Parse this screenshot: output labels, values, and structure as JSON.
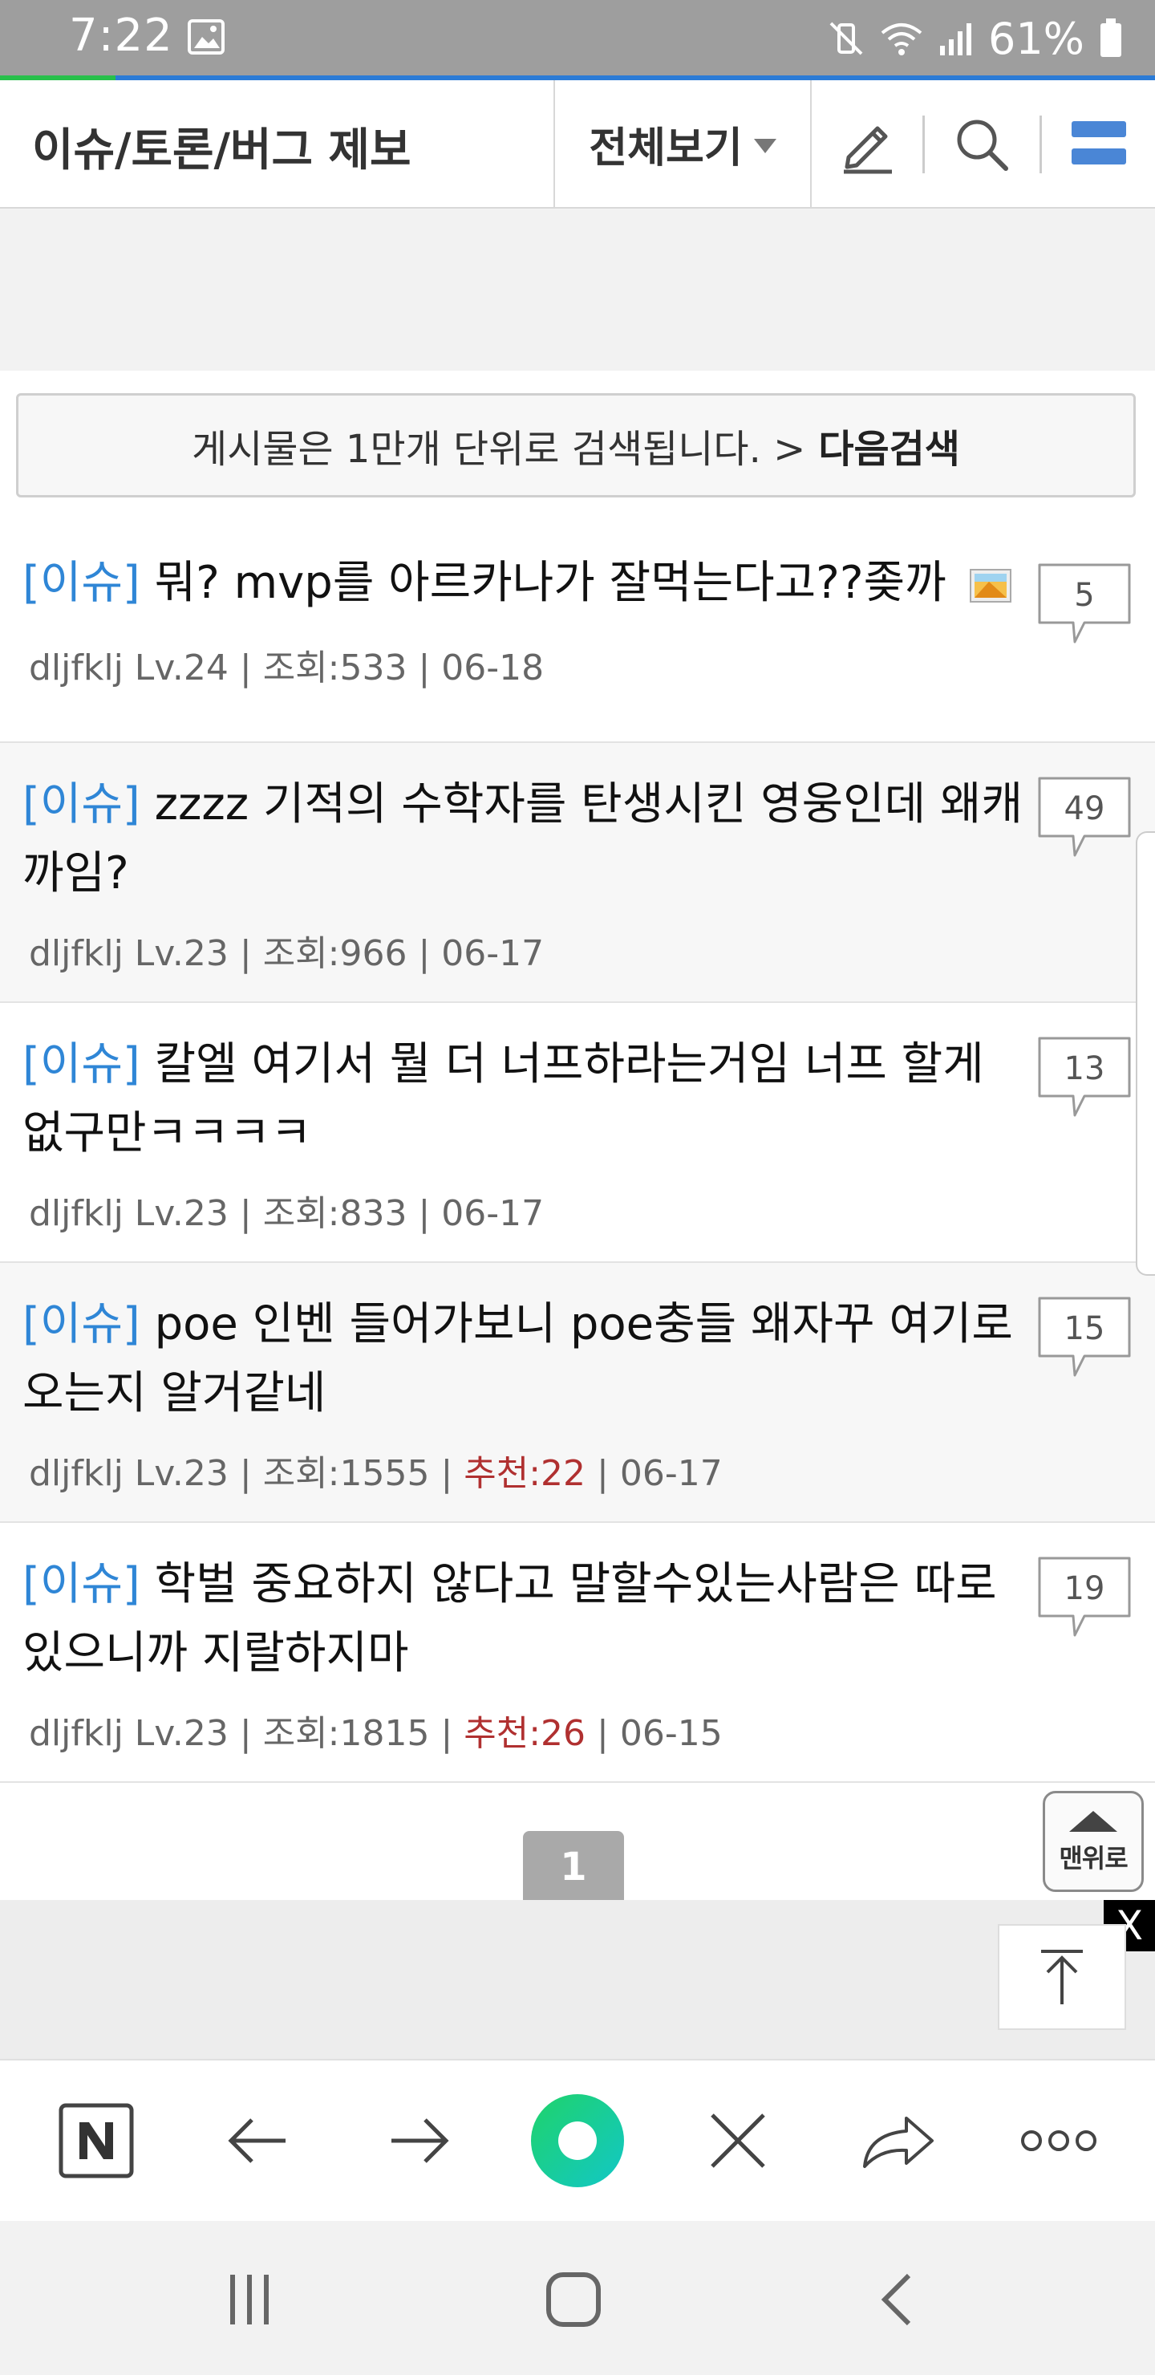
{
  "status_bar": {
    "time": "7:22",
    "battery": "61%"
  },
  "header": {
    "title": "이슈/토론/버그 제보",
    "view_all": "전체보기"
  },
  "notice": {
    "text": "게시물은 1만개 단위로 검색됩니다. >",
    "link": "다음검색"
  },
  "posts": [
    {
      "tag": "[이슈]",
      "title": "뭐? mvp를 아르카나가 잘먹는다고??좆까",
      "has_image": true,
      "author": "dljfklj Lv.24",
      "views": "조회:533",
      "recommend": "",
      "date": "06-18",
      "comments": "5"
    },
    {
      "tag": "[이슈]",
      "title": "zzzz 기적의 수학자를 탄생시킨 영웅인데 왜캐 까임?",
      "has_image": false,
      "author": "dljfklj Lv.23",
      "views": "조회:966",
      "recommend": "",
      "date": "06-17",
      "comments": "49"
    },
    {
      "tag": "[이슈]",
      "title": "칼엘 여기서 뭘 더 너프하라는거임 너프 할게 없구만ㅋㅋㅋㅋ",
      "has_image": false,
      "author": "dljfklj Lv.23",
      "views": "조회:833",
      "recommend": "",
      "date": "06-17",
      "comments": "13"
    },
    {
      "tag": "[이슈]",
      "title": "poe 인벤 들어가보니 poe충들 왜자꾸 여기로 오는지 알거같네",
      "has_image": false,
      "author": "dljfklj Lv.23",
      "views": "조회:1555",
      "recommend": "추천:22",
      "date": "06-17",
      "comments": "15"
    },
    {
      "tag": "[이슈]",
      "title": "학벌 중요하지 않다고 말할수있는사람은 따로있으니까 지랄하지마",
      "has_image": false,
      "author": "dljfklj Lv.23",
      "views": "조회:1815",
      "recommend": "추천:26",
      "date": "06-15",
      "comments": "19"
    }
  ],
  "pagination": {
    "current": "1"
  },
  "to_top": {
    "label": "맨위로"
  },
  "ad": {
    "close": "X"
  },
  "colors": {
    "tag": "#2f86d6",
    "recommend": "#b03030",
    "accent_bar": "#2b7bd6",
    "progress_fill": "#27c04a"
  },
  "page_load_progress": 0.1,
  "toolbar_icons": [
    "naver-n-icon",
    "back-arrow-icon",
    "forward-arrow-icon",
    "green-dot-icon",
    "close-icon",
    "share-icon",
    "more-icon"
  ],
  "nav_icons": [
    "recent-apps-icon",
    "home-icon",
    "back-icon"
  ]
}
